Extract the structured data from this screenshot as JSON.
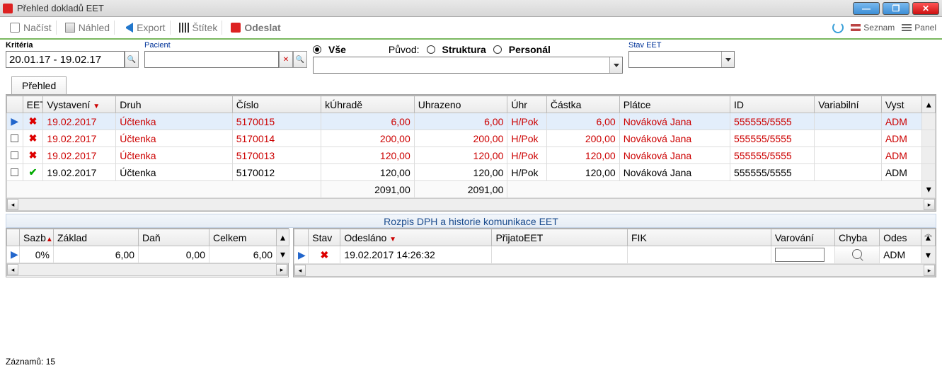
{
  "window": {
    "title": "Přehled dokladů EET"
  },
  "toolbar": {
    "load": "Načíst",
    "preview": "Náhled",
    "export": "Export",
    "label": "Štítek",
    "send": "Odeslat",
    "listing": "Seznam",
    "panel": "Panel"
  },
  "criteria": {
    "criteria_label": "Kritéria",
    "patient_label": "Pacient",
    "all": "Vše",
    "origin_label": "Původ:",
    "origin_structure": "Struktura",
    "origin_personal": "Personál",
    "state_label": "Stav EET",
    "date_value": "20.01.17 - 19.02.17"
  },
  "tab": {
    "overview": "Přehled"
  },
  "grid": {
    "cols": {
      "eet": "EET",
      "issued": "Vystavení",
      "kind": "Druh",
      "number": "Číslo",
      "to_pay": "kÚhradě",
      "paid": "Uhrazeno",
      "uhr": "Úhr",
      "amount": "Částka",
      "payer": "Plátce",
      "id": "ID",
      "varsym": "Variabilní",
      "issuer": "Vyst"
    },
    "rows": [
      {
        "eet": "x",
        "date": "19.02.2017",
        "kind": "Účtenka",
        "num": "5170015",
        "to_pay": "6,00",
        "paid": "6,00",
        "uhr": "H/Pok",
        "amt": "6,00",
        "payer": "Nováková Jana",
        "id": "555555/5555",
        "vs": "",
        "iss": "ADM",
        "red": true,
        "sel": true
      },
      {
        "eet": "x",
        "date": "19.02.2017",
        "kind": "Účtenka",
        "num": "5170014",
        "to_pay": "200,00",
        "paid": "200,00",
        "uhr": "H/Pok",
        "amt": "200,00",
        "payer": "Nováková Jana",
        "id": "555555/5555",
        "vs": "",
        "iss": "ADM",
        "red": true
      },
      {
        "eet": "x",
        "date": "19.02.2017",
        "kind": "Účtenka",
        "num": "5170013",
        "to_pay": "120,00",
        "paid": "120,00",
        "uhr": "H/Pok",
        "amt": "120,00",
        "payer": "Nováková Jana",
        "id": "555555/5555",
        "vs": "",
        "iss": "ADM",
        "red": true
      },
      {
        "eet": "ok",
        "date": "19.02.2017",
        "kind": "Účtenka",
        "num": "5170012",
        "to_pay": "120,00",
        "paid": "120,00",
        "uhr": "H/Pok",
        "amt": "120,00",
        "payer": "Nováková Jana",
        "id": "555555/5555",
        "vs": "",
        "iss": "ADM",
        "red": false
      }
    ],
    "sum_to_pay": "2091,00",
    "sum_paid": "2091,00"
  },
  "section_title": "Rozpis DPH a historie komunikace EET",
  "dph": {
    "cols": {
      "rate": "Sazb",
      "base": "Základ",
      "tax": "Daň",
      "total": "Celkem"
    },
    "row": {
      "rate": "0%",
      "base": "6,00",
      "tax": "0,00",
      "total": "6,00"
    }
  },
  "hist": {
    "cols": {
      "state": "Stav",
      "sent": "Odesláno",
      "received": "PřijatoEET",
      "fik": "FIK",
      "warn": "Varování",
      "err": "Chyba",
      "sender": "Odes"
    },
    "row": {
      "state": "x",
      "sent": "19.02.2017 14:26:32",
      "received": "",
      "fik": "",
      "warn": "",
      "err": "",
      "sender": "ADM"
    }
  },
  "status": "Záznamů: 15"
}
